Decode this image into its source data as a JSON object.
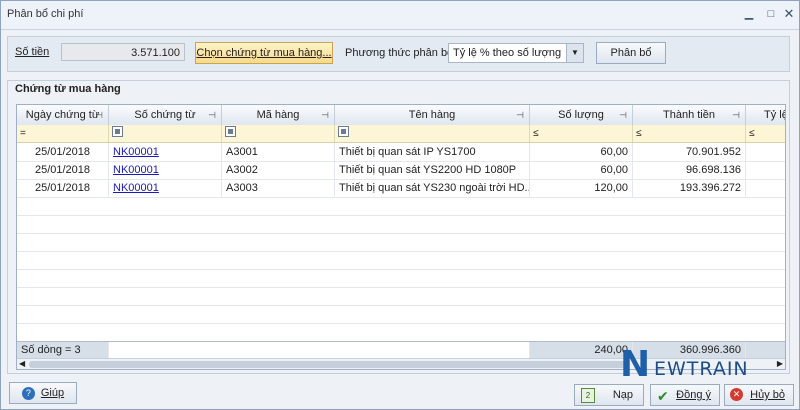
{
  "window": {
    "title": "Phân bổ chi phí"
  },
  "top": {
    "amount_label": "Số tiền",
    "amount_value": "3.571.100",
    "choose_button": "Chọn chứng từ mua hàng...",
    "method_label": "Phương thức phân bổ",
    "method_value": "Tỷ lệ % theo số lượng",
    "allocate_button": "Phân bổ"
  },
  "group": {
    "title": "Chứng từ mua hàng"
  },
  "grid": {
    "columns": [
      "Ngày chứng từ",
      "Số chứng từ",
      "Mã hàng",
      "Tên hàng",
      "Số lượng",
      "Thành tiền",
      "Tỷ lệ"
    ],
    "filters": [
      "=",
      "",
      "",
      "",
      "≤",
      "≤",
      "≤"
    ],
    "rows": [
      {
        "date": "25/01/2018",
        "doc": "NK00001",
        "code": "A3001",
        "name": "Thiết bị quan sát IP YS1700",
        "qty": "60,00",
        "amount": "70.901.952"
      },
      {
        "date": "25/01/2018",
        "doc": "NK00001",
        "code": "A3002",
        "name": "Thiết bị quan sát YS2200 HD 1080P",
        "qty": "60,00",
        "amount": "96.698.136"
      },
      {
        "date": "25/01/2018",
        "doc": "NK00001",
        "code": "A3003",
        "name": "Thiết bị quan sát YS230 ngoài trời HD...",
        "qty": "120,00",
        "amount": "193.396.272"
      }
    ],
    "footer": {
      "count": "Số dòng = 3",
      "qty_total": "240,00",
      "amount_total": "360.996.360"
    }
  },
  "bottom": {
    "help_button": "Giúp",
    "load_button": "Nạp",
    "agree_button": "Đồng ý",
    "cancel_button": "Hủy bỏ"
  },
  "logo": {
    "text_n": "N",
    "text_rest": "EWTRAIN"
  },
  "colors": {
    "link": "#1a1ab8",
    "filter_row": "#fdf6d6",
    "primary_button": "#f7d98a"
  }
}
